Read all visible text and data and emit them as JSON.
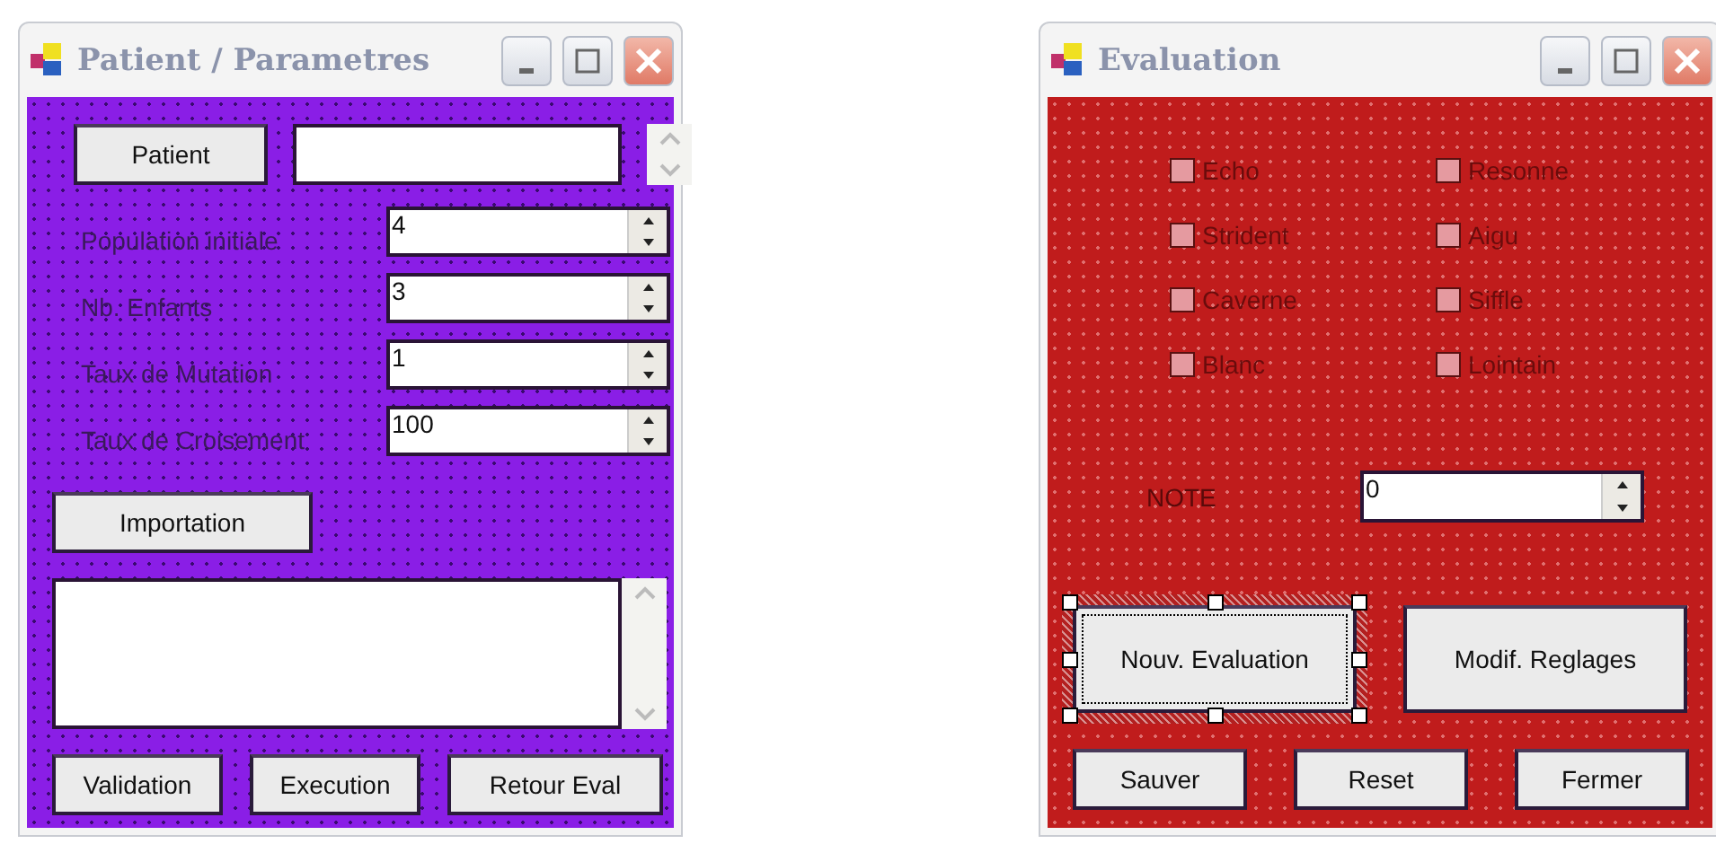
{
  "patient_window": {
    "title": "Patient / Parametres",
    "patient_button": "Patient",
    "parameters": [
      {
        "label": "Population initiale",
        "value": "4"
      },
      {
        "label": "Nb. Enfants",
        "value": "3"
      },
      {
        "label": "Taux de Mutation",
        "value": "1"
      },
      {
        "label": "Taux de Croisement",
        "value": "100"
      }
    ],
    "import_button": "Importation",
    "buttons": [
      "Validation",
      "Execution",
      "Retour Eval"
    ]
  },
  "evaluation_window": {
    "title": "Evaluation",
    "checkboxes": [
      {
        "label": "Echo",
        "checked": false
      },
      {
        "label": "Resonne",
        "checked": false
      },
      {
        "label": "Strident",
        "checked": false
      },
      {
        "label": "Aigu",
        "checked": false
      },
      {
        "label": "Caverne",
        "checked": false
      },
      {
        "label": "Siffle",
        "checked": false
      },
      {
        "label": "Blanc",
        "checked": false
      },
      {
        "label": "Lointain",
        "checked": false
      }
    ],
    "note": {
      "label": "NOTE",
      "value": "0"
    },
    "large_buttons": [
      {
        "label": "Nouv. Evaluation",
        "selected": true
      },
      {
        "label": "Modif. Reglages",
        "selected": false
      }
    ],
    "buttons": [
      "Sauver",
      "Reset",
      "Fermer"
    ]
  }
}
